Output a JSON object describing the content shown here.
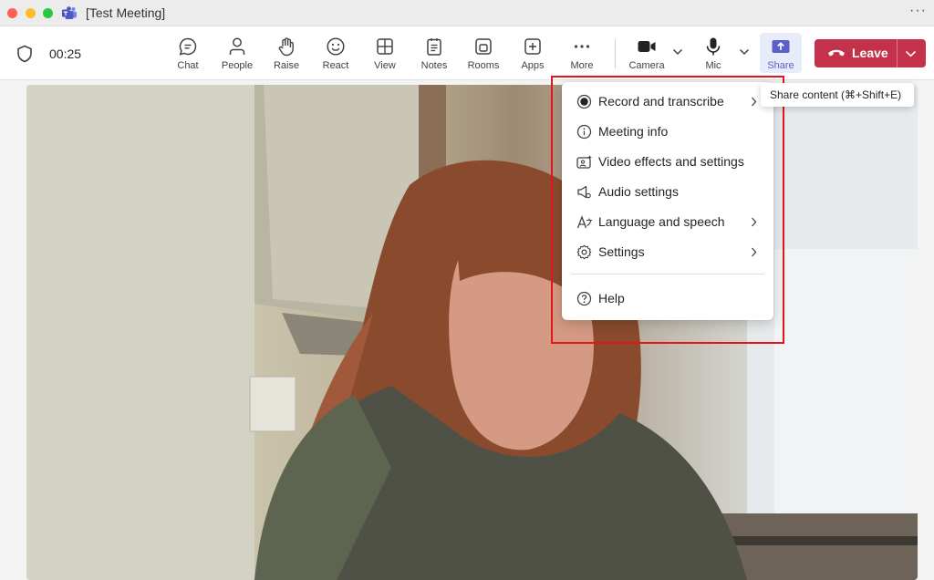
{
  "window": {
    "title": "[Test Meeting]"
  },
  "toolbar": {
    "timer": "00:25",
    "buttons": [
      {
        "label": "Chat"
      },
      {
        "label": "People"
      },
      {
        "label": "Raise"
      },
      {
        "label": "React"
      },
      {
        "label": "View"
      },
      {
        "label": "Notes"
      },
      {
        "label": "Rooms"
      },
      {
        "label": "Apps"
      },
      {
        "label": "More"
      }
    ],
    "camera_label": "Camera",
    "mic_label": "Mic",
    "share_label": "Share",
    "leave_label": "Leave"
  },
  "tooltip": {
    "text": "Share content (⌘+Shift+E)"
  },
  "more_menu": {
    "items": [
      {
        "label": "Record and transcribe",
        "icon": "record-icon",
        "submenu": true
      },
      {
        "label": "Meeting info",
        "icon": "info-icon",
        "submenu": false
      },
      {
        "label": "Video effects and settings",
        "icon": "video-effects-icon",
        "submenu": false
      },
      {
        "label": "Audio settings",
        "icon": "speaker-icon",
        "submenu": false
      },
      {
        "label": "Language and speech",
        "icon": "language-icon",
        "submenu": true
      },
      {
        "label": "Settings",
        "icon": "gear-icon",
        "submenu": true
      }
    ],
    "help_label": "Help"
  },
  "colors": {
    "leave": "#c4314b",
    "accent": "#5b5fc7",
    "highlight": "#e4141b"
  }
}
